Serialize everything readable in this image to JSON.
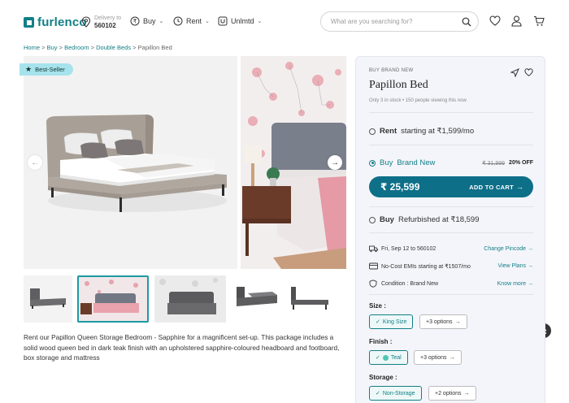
{
  "header": {
    "logo_text": "furlenco",
    "delivery_label": "Delivery to",
    "delivery_pincode": "560102",
    "nav": [
      {
        "label": "Buy"
      },
      {
        "label": "Rent"
      },
      {
        "label": "Unlmtd"
      }
    ],
    "search_placeholder": "What are you searching for?"
  },
  "breadcrumb": {
    "items": [
      "Home",
      "Buy",
      "Bedroom",
      "Double Beds"
    ],
    "sep": ">",
    "current": "Papillon Bed"
  },
  "gallery": {
    "badge": "Best-Seller"
  },
  "description": "Rent our Papillon Queen Storage Bedroom - Sapphire for a magnificent set-up. This package includes a solid wood queen bed in dark teak finish with an upholstered sapphire-coloured headboard and footboard, box storage and mattress",
  "panel": {
    "tag": "BUY BRAND NEW",
    "title": "Papillon Bed",
    "stock": "Only 3 in stock • 150 people viewing this now",
    "rent": {
      "bold": "Rent",
      "text": "starting at ₹1,599/mo"
    },
    "buy_new": {
      "bold": "Buy",
      "text": "Brand New",
      "old_price": "₹ 31,999",
      "discount": "20% OFF"
    },
    "cart": {
      "price": "₹ 25,599",
      "label": "ADD TO CART"
    },
    "refurb": {
      "bold": "Buy",
      "text": "Refurbished at ₹18,599"
    },
    "info": [
      {
        "text": "Fri, Sep 12 to 560102",
        "link": "Change Pincode"
      },
      {
        "text": "No-Cost EMIs starting at ₹1507/mo",
        "link": "View Plans"
      },
      {
        "text": "Condition : Brand New",
        "link": "Know more"
      }
    ],
    "size": {
      "label": "Size :",
      "selected": "King Size",
      "more": "+3 options"
    },
    "finish": {
      "label": "Finish :",
      "selected": "Teal",
      "more": "+3 options",
      "swatch": "#4ec7b0"
    },
    "storage": {
      "label": "Storage :",
      "selected": "Non-Storage",
      "more": "+2 options"
    }
  },
  "colors": {
    "brand": "#127f86",
    "cart": "#0e6f88",
    "badge": "#a6e3ec"
  }
}
